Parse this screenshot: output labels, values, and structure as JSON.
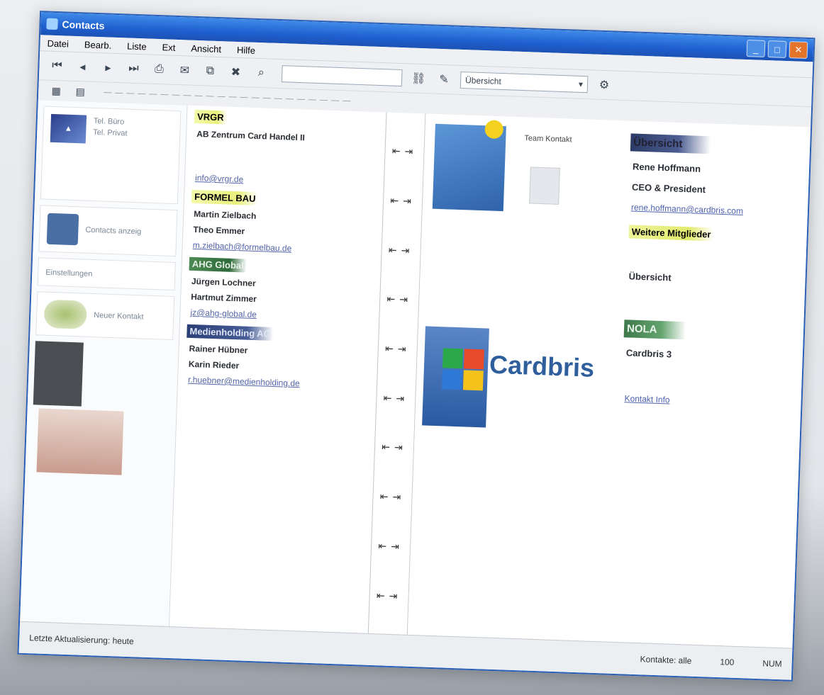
{
  "window": {
    "title": "Contacts"
  },
  "menu": [
    "Datei",
    "Bearb.",
    "Liste",
    "Ext",
    "Ansicht",
    "Hilfe"
  ],
  "toolbar": {
    "search_placeholder": "",
    "select_value": "Übersicht"
  },
  "left": {
    "card1_lines": [
      "Tel. Büro",
      "Tel. Privat"
    ],
    "card2_text": "Contacts anzeig",
    "card3_text": "Einstellungen",
    "card4_text": "Neuer Kontakt"
  },
  "groups": [
    {
      "head": "VRGR",
      "style": "yellow",
      "lines": [
        "AB Zentrum Card Handel II"
      ],
      "link": "info@vrgr.de"
    },
    {
      "head": "FORMEL BAU",
      "style": "yellow",
      "lines": [
        "Martin Zielbach",
        "Theo Emmer"
      ],
      "link": "m.zielbach@formelbau.de"
    },
    {
      "head": "AHG Global",
      "style": "green",
      "lines": [
        "Jürgen Lochner",
        "Hartmut Zimmer"
      ],
      "link": "jz@ahg-global.de"
    },
    {
      "head": "Medienholding AG",
      "style": "blue",
      "lines": [
        "Rainer Hübner",
        "Karin Rieder"
      ],
      "link": "r.huebner@medienholding.de"
    }
  ],
  "right": {
    "side_text": "Team Kontakt",
    "brand": "Cardbris",
    "head1": "Übersicht",
    "lines": [
      "Rene Hoffmann",
      "CEO & President"
    ],
    "link1": "rene.hoffmann@cardbris.com",
    "highlight": "Weitere Mitglieder",
    "line2": "Übersicht",
    "head2": "NOLA",
    "line3": "Cardbris 3",
    "link2": "Kontakt Info"
  },
  "status": {
    "left": "Letzte Aktualisierung: heute",
    "mid": "Kontakte: alle",
    "mid2": "100",
    "right": "NUM"
  },
  "colors": {
    "titlebar": "#1f5fcf",
    "accent_green": "#3f7a4a",
    "brand_blue": "#2f5e9c"
  }
}
